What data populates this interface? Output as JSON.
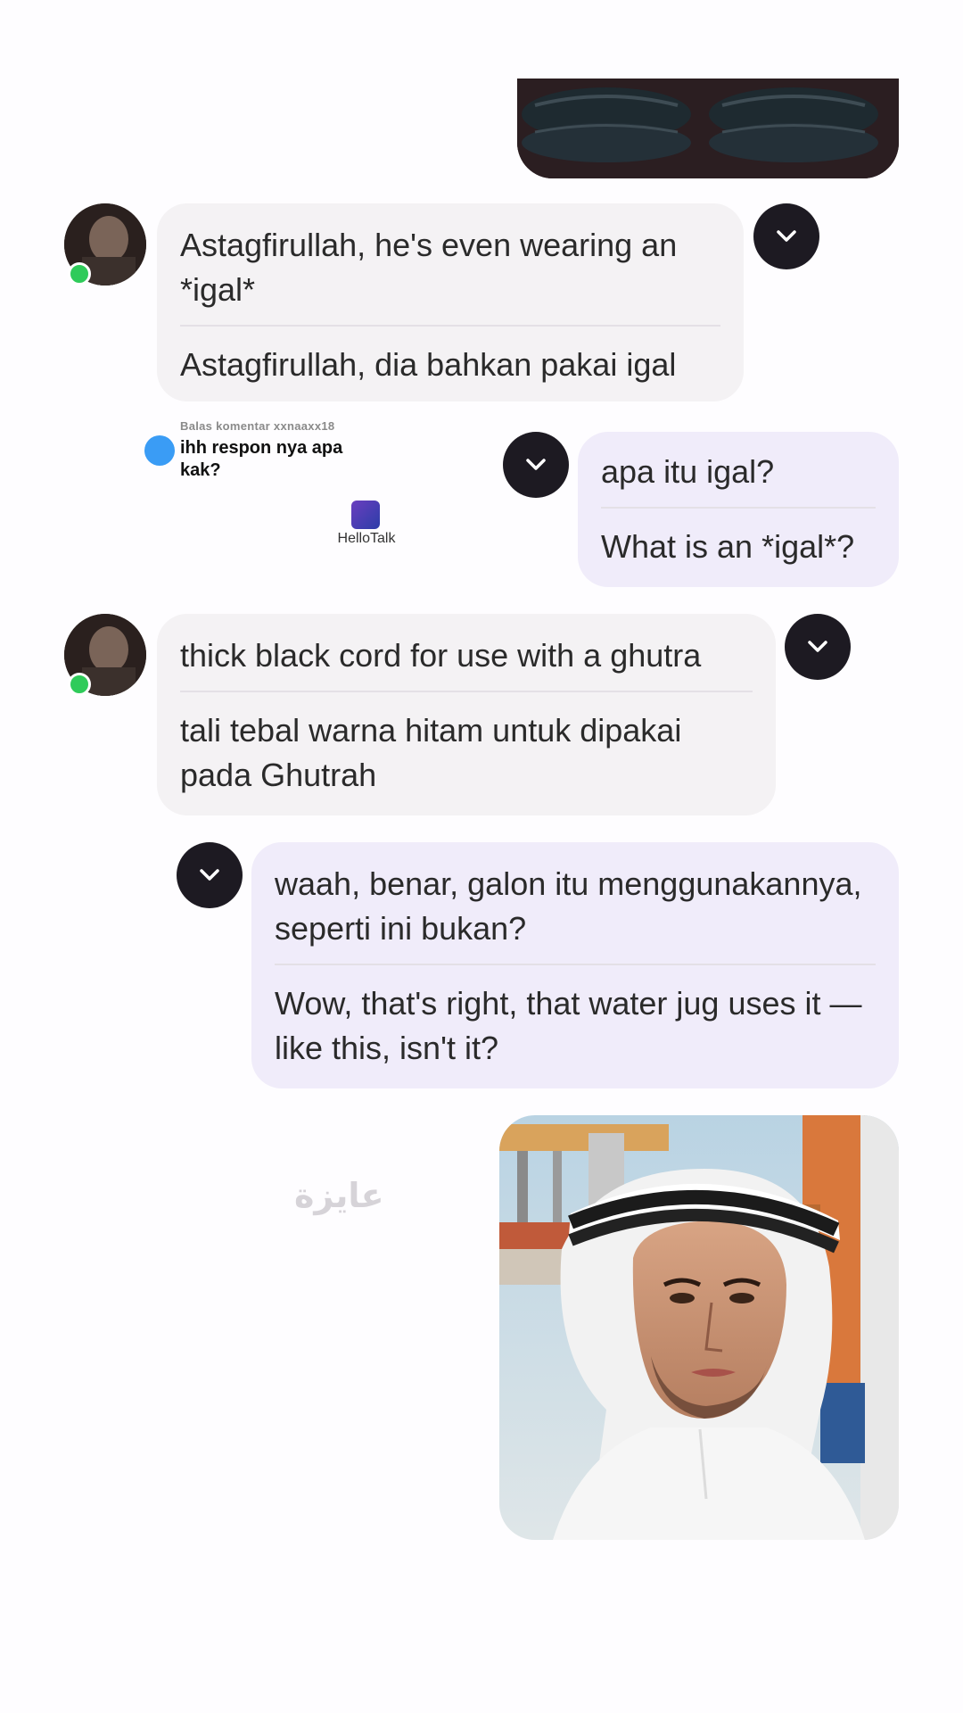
{
  "messages": [
    {
      "original": "Astagfirullah, he's even wearing an *igal*",
      "translation": "Astagfirullah, dia bahkan pakai igal"
    },
    {
      "original": "apa itu igal?",
      "translation": "What is an *igal*?"
    },
    {
      "original": "thick black cord for use with a ghutra",
      "translation": "tali tebal warna hitam untuk dipakai pada Ghutrah"
    },
    {
      "original": "waah, benar, galon itu menggunakannya, seperti ini bukan?",
      "translation": "Wow, that's right, that water jug uses it —like this, isn't it?"
    }
  ],
  "reply_comment": {
    "label": "Balas komentar xxnaaxx18",
    "text": "ihh respon nya apa kak?"
  },
  "hellotalk": {
    "label": "HelloTalk"
  },
  "watermark": "عايزة",
  "colors": {
    "incoming_bubble": "#f4f2f4",
    "outgoing_bubble": "#f0ecfa",
    "chevron_button": "#1d1a22",
    "online_dot": "#2fcb5a",
    "reply_dot": "#3a9cf5"
  },
  "icons": {
    "chevron": "chevron-down-icon",
    "online": "online-status-icon"
  }
}
